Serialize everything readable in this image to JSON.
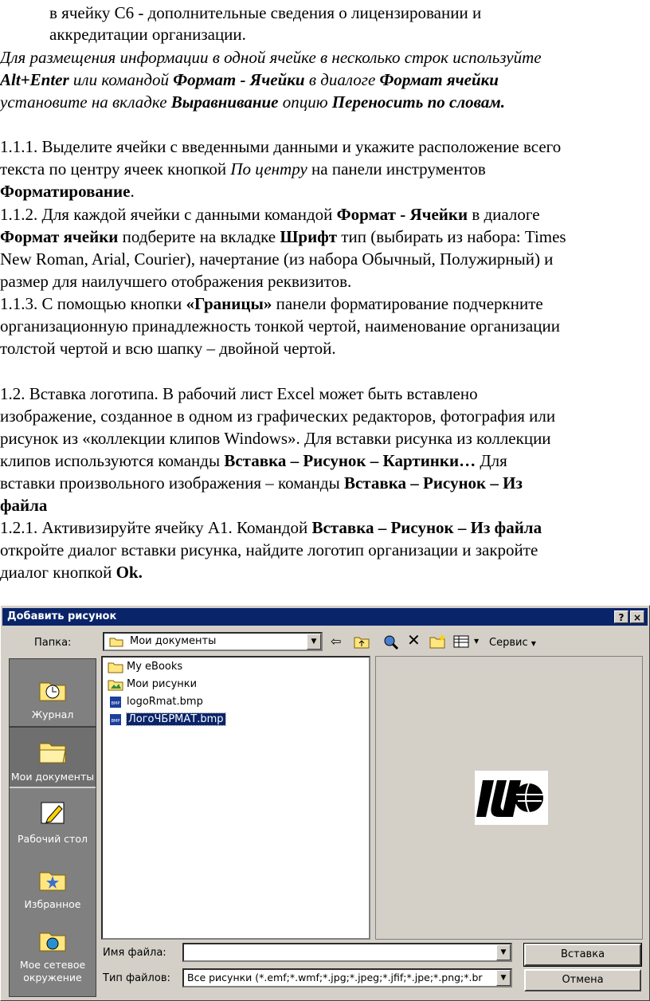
{
  "document": {
    "p0": {
      "l1": "в ячейку С6 -  дополнительные сведения о лицензировании и",
      "l2": "аккредитации организации."
    },
    "note": {
      "l1": "Для размещения информации в одной ячейке в несколько строк используйте",
      "l2a": "Alt+Enter",
      "l2b": "или командой",
      "l2c": "Формат -",
      "l2d": "Ячейки",
      "l2e": "в диалоге",
      "l2f": "Формат ячейки",
      "l3a": "установите на вкладке ",
      "l3b": "Выравнивание",
      "l3c": " опцию ",
      "l3d": "Переносить по словам."
    },
    "s111": {
      "l1": "1.1.1. Выделите ячейки с введенными данными и укажите расположение всего",
      "l2a": "текста",
      "l2b": "по",
      "l2c": "центру",
      "l2d": "ячеек",
      "l2e": "кнопкой",
      "l2f": "По центру",
      "l2g": "на",
      "l2h": "панели",
      "l2i": "инструментов",
      "l3a": "Форматирование",
      "l3b": "."
    },
    "s112": {
      "l1a": "1.1.2. Для каждой  ячейки с данными  командой ",
      "l1b": "Формат -  Ячейки",
      "l1c": " в диалоге",
      "l2a": "Формат ячейки",
      "l2b": " подберите на вкладке ",
      "l2c": "Шрифт",
      "l2d": " тип (выбирать из набора: Times",
      "l3": "New Roman, Arial, Courier), начертание  (из набора Обычный, Полужирный)  и",
      "l4": "размер для наилучшего отображения реквизитов."
    },
    "s113": {
      "l1a": "1.1.3. С помощью кнопки ",
      "l1b": "«Границы»",
      "l1c": " панели форматирование подчеркните",
      "l2": "организационную принадлежность тонкой чертой, наименование организации",
      "l3": "толстой чертой и всю шапку – двойной чертой."
    },
    "s12": {
      "l1": "1.2.  Вставка  логотипа.  В  рабочий  лист  Excel  может  быть  вставлено",
      "l2": "изображение, созданное в одном из графических редакторов, фотография или",
      "l3": "рисунок из «коллекции клипов Windows». Для вставки рисунка из коллекции",
      "l4a": "клипов используются команды ",
      "l4b": "Вставка – Рисунок – Картинки…",
      "l4c": " Для",
      "l5a": "вставки произвольного изображения – команды ",
      "l5b": "Вставка – Рисунок – Из",
      "l6": "файла"
    },
    "s121": {
      "l1a": "1.2.1. Активизируйте ячейку А1. Командой ",
      "l1b": "Вставка – Рисунок – Из файла",
      "l2": "откройте диалог вставки рисунка, найдите логотип организации  и закройте",
      "l3a": "диалог кнопкой ",
      "l3b": "Ok."
    }
  },
  "dialog": {
    "title": "Добавить рисунок",
    "help_btn": "?",
    "close_btn": "×",
    "folder_label": "Папка:",
    "folder_value": "Мои документы",
    "service_label": "Сервис",
    "places": [
      "Журнал",
      "Мои документы",
      "Рабочий стол",
      "Избранное",
      "Мое сетевое окружение"
    ],
    "files": [
      "My eBooks",
      "Мои рисунки",
      "logoRmat.bmp",
      "ЛогоЧБРМАТ.bmp"
    ],
    "filename_label": "Имя файла:",
    "filename_value": "",
    "filetype_label": "Тип файлов:",
    "filetype_value": "Все рисунки (*.emf;*.wmf;*.jpg;*.jpeg;*.jfif;*.jpe;*.png;*.br",
    "insert_btn": "Вставка",
    "cancel_btn": "Отмена"
  }
}
